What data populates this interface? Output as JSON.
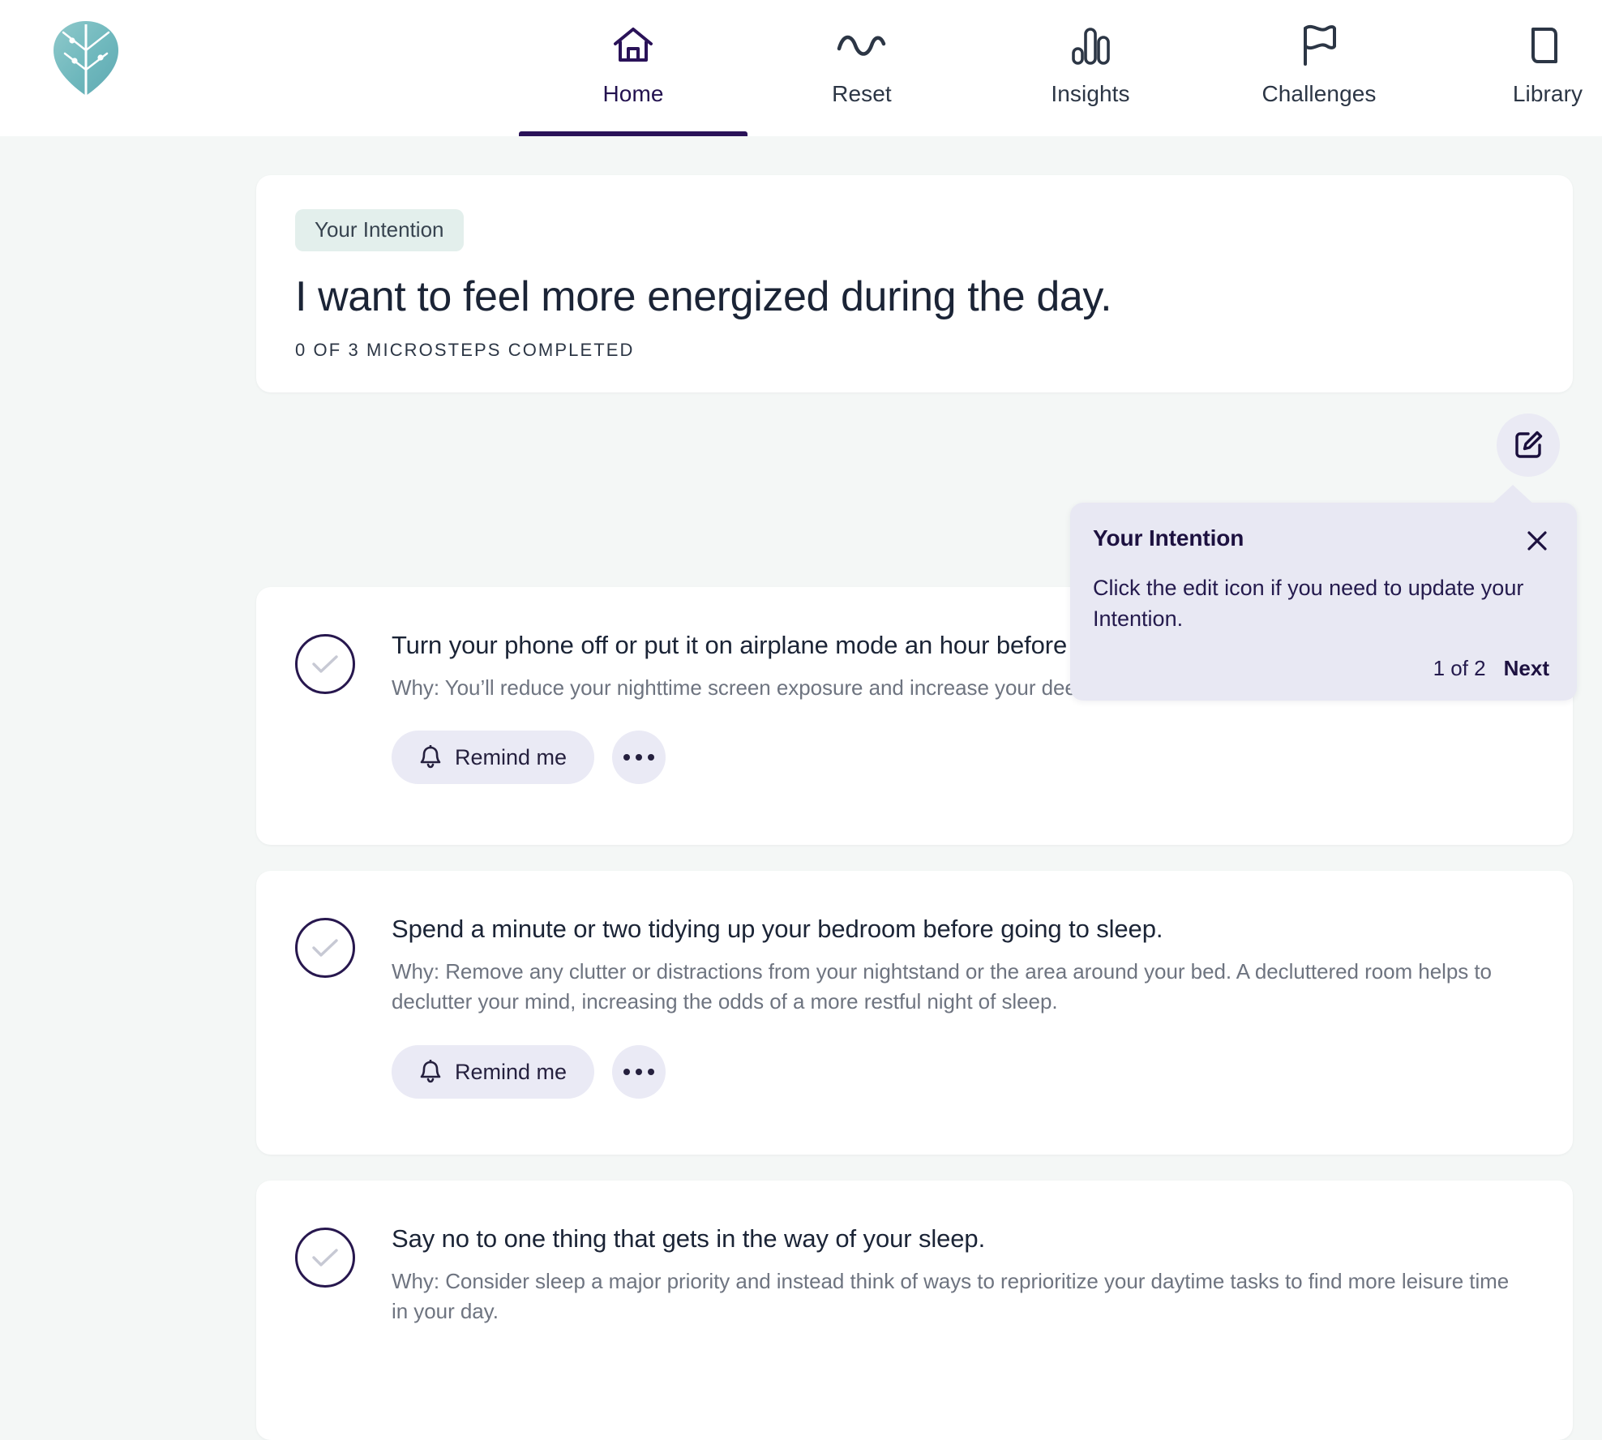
{
  "nav": {
    "logo_name": "thrive-leaf-logo",
    "items": [
      {
        "label": "Home",
        "icon": "home-icon",
        "active": true
      },
      {
        "label": "Reset",
        "icon": "wave-icon",
        "active": false
      },
      {
        "label": "Insights",
        "icon": "bar-chart-icon",
        "active": false
      },
      {
        "label": "Challenges",
        "icon": "flag-icon",
        "active": false
      },
      {
        "label": "Library",
        "icon": "book-icon",
        "active": false
      }
    ]
  },
  "intention": {
    "badge": "Your Intention",
    "title": "I want to feel more energized during the day.",
    "progress": "0 OF 3 MICROSTEPS COMPLETED",
    "edit_icon": "edit-square-pencil-icon"
  },
  "steps": [
    {
      "title": "Turn your phone off or put it on airplane mode an hour before bed.",
      "why": "Why: You’ll reduce your nighttime screen exposure and increase your deep sleep.",
      "remind_label": "Remind me",
      "checked": false
    },
    {
      "title": "Spend a minute or two tidying up your bedroom before going to sleep.",
      "why": "Why: Remove any clutter or distractions from your nightstand or the area around your bed. A decluttered room helps to declutter your mind, increasing the odds of a more restful night of sleep.",
      "remind_label": "Remind me",
      "checked": false
    },
    {
      "title": "Say no to one thing that gets in the way of your sleep.",
      "why": "Why: Consider sleep a major priority and instead think of ways to reprioritize your daytime tasks to find more leisure time in your day.",
      "remind_label": "",
      "checked": false
    }
  ],
  "tooltip": {
    "title": "Your Intention",
    "body": "Click the edit icon if you need to update your Intention.",
    "counter": "1 of 2",
    "next_label": "Next",
    "close_icon": "close-icon"
  },
  "colors": {
    "page_bg": "#f4f7f6",
    "card_bg": "#ffffff",
    "accent_purple": "#2a1258",
    "tooltip_bg": "#e8e8f3",
    "badge_bg": "#e3efec",
    "pill_bg": "#eaeaf5",
    "logo_teal": "#7fc0c4",
    "text_dark": "#1b2436",
    "text_muted": "#6e7480"
  }
}
